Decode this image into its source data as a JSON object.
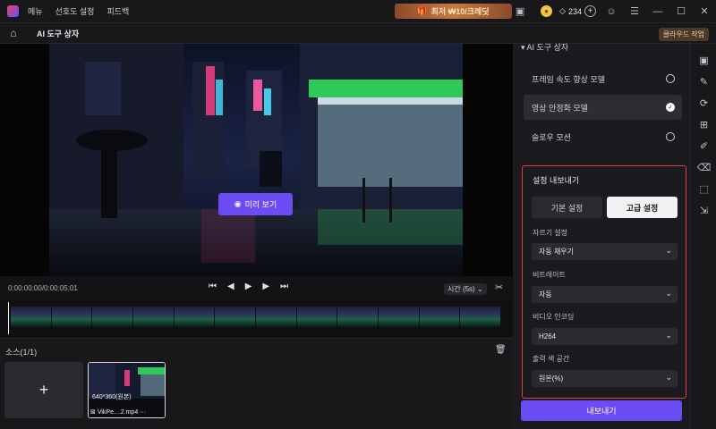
{
  "titlebar": {
    "menu": [
      "메뉴",
      "선호도 설정",
      "피드백"
    ],
    "promo": "최저 ₩10/크레딧",
    "credits": "234"
  },
  "subbar": {
    "title": "AI 도구 상자",
    "cloud_button": "클라우드 작업"
  },
  "preview": {
    "button_label": "미리 보기"
  },
  "controls": {
    "time": "0:00:00:00/0:00:05:01",
    "speed": "시간 (5s)"
  },
  "source": {
    "title": "소스(1/1)",
    "clip_resolution": "640*360(원본)",
    "clip_name": "VikPe....2.mp4"
  },
  "right_panel": {
    "section_title": "AI 도구 상자",
    "models": [
      {
        "label": "프레임 속도 향상 모델",
        "selected": false
      },
      {
        "label": "영상 안정화 모델",
        "selected": true
      },
      {
        "label": "슬로우 모션",
        "selected": false
      }
    ],
    "export": {
      "title": "설정 내보내기",
      "tab_basic": "기본 설정",
      "tab_advanced": "고급 설정",
      "crop_label": "자르기 설정",
      "crop_value": "자동 채우기",
      "bitrate_label": "비트레이트",
      "bitrate_value": "자동",
      "codec_label": "비디오 인코딩",
      "codec_value": "H264",
      "colorspace_label": "출력 색 공간",
      "colorspace_value": "원본(%)",
      "export_button": "내보내기"
    }
  },
  "colors": {
    "accent": "#6a4cf2",
    "highlight_border": "#e04040"
  }
}
